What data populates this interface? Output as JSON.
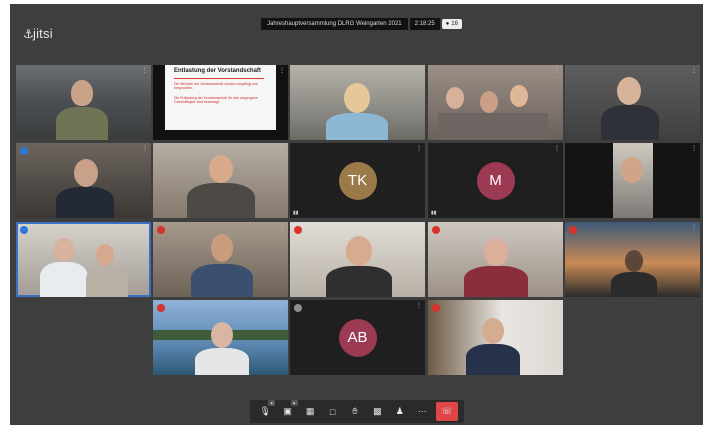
{
  "app": {
    "logo_text": "jitsi"
  },
  "meeting": {
    "title": "Jahreshauptversammlung DLRG Weingarten 2021",
    "timer": "2:18:25",
    "participant_count": "16"
  },
  "tiles": [
    {
      "id": "r1c1",
      "kind": "video",
      "mic": "none"
    },
    {
      "id": "r1c2",
      "kind": "screenshare"
    },
    {
      "id": "r1c3",
      "kind": "video",
      "mic": "none"
    },
    {
      "id": "r1c4",
      "kind": "video",
      "mic": "none"
    },
    {
      "id": "r1c5",
      "kind": "video",
      "mic": "none"
    },
    {
      "id": "r2c1",
      "kind": "video",
      "mic": "blue"
    },
    {
      "id": "r2c2",
      "kind": "video",
      "mic": "none"
    },
    {
      "id": "r2c3",
      "kind": "avatar",
      "initials": "TK",
      "color": "#9b7a4a"
    },
    {
      "id": "r2c4",
      "kind": "avatar",
      "initials": "M",
      "color": "#9b3a52"
    },
    {
      "id": "r2c5",
      "kind": "video",
      "mic": "none"
    },
    {
      "id": "r3c1",
      "kind": "video",
      "mic": "blue"
    },
    {
      "id": "r3c2",
      "kind": "video",
      "mic": "red"
    },
    {
      "id": "r3c3",
      "kind": "video",
      "mic": "red"
    },
    {
      "id": "r3c4",
      "kind": "video",
      "mic": "red"
    },
    {
      "id": "r3c5",
      "kind": "video",
      "mic": "red"
    },
    {
      "id": "r4c2",
      "kind": "video",
      "mic": "red"
    },
    {
      "id": "r4c3",
      "kind": "avatar",
      "initials": "AB",
      "color": "#9b3a52"
    },
    {
      "id": "r4c4",
      "kind": "video",
      "mic": "red"
    }
  ],
  "slide": {
    "title": "Entlastung der Vorstandschaft",
    "line1": "Die Berichte der Vorstandschaft wurden vorgelegt und besprochen.",
    "line2": "Die Entlastung der Vorstandschaft für das vergangene Geschäftsjahr wird beantragt."
  },
  "toolbar": {
    "items": [
      "microphone-icon",
      "camera-icon",
      "screenshare-icon",
      "chat-icon",
      "raise-hand-icon",
      "tile-view-icon",
      "participants-icon",
      "more-icon",
      "hangup-icon"
    ],
    "hangup_color": "#e14646"
  },
  "colors": {
    "background": "#3e3e3e",
    "tile": "#1f1f1f",
    "speaking_border": "#3b6fc6",
    "muted": "#d9312b"
  }
}
